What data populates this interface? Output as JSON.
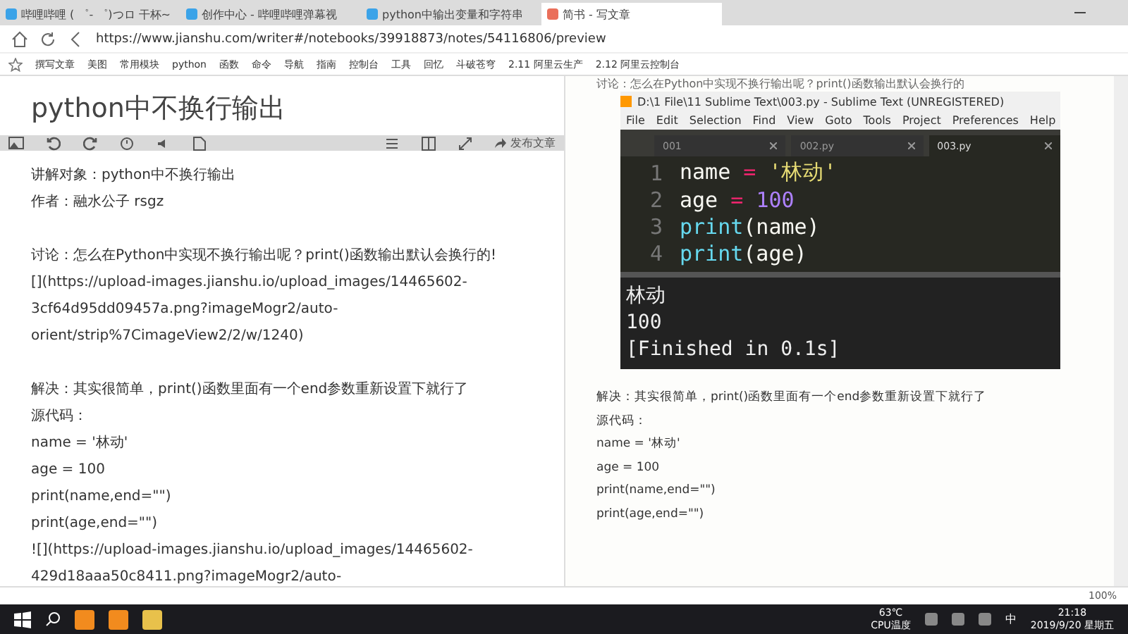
{
  "browser": {
    "tabs": [
      {
        "label": "哔哩哔哩 ( ゜- ゜)つロ 干杯~",
        "selected": false
      },
      {
        "label": "创作中心 - 哔哩哔哩弹幕视",
        "selected": false
      },
      {
        "label": "python中输出变量和字符串",
        "selected": false
      },
      {
        "label": "简书 - 写文章",
        "selected": true
      }
    ],
    "url": "https://www.jianshu.com/writer#/notebooks/39918873/notes/54116806/preview",
    "bookmarks": [
      "撰写文章",
      "美图",
      "常用模块",
      "python",
      "函数",
      "命令",
      "导航",
      "指南",
      "控制台",
      "工具",
      "回忆",
      "斗破苍穹",
      "2.11 阿里云生产",
      "2.12 阿里云控制台"
    ],
    "zoom": "100%"
  },
  "editor": {
    "title": "python中不换行输出",
    "publish": "发布文章",
    "paragraphs": [
      [
        "讲解对象：python中不换行输出",
        "作者：融水公子 rsgz"
      ],
      [
        "讨论：怎么在Python中实现不换行输出呢？print()函数输出默认会换行的!",
        "[](https://upload-images.jianshu.io/upload_images/14465602-",
        "3cf64d95dd09457a.png?imageMogr2/auto-",
        "orient/strip%7CimageView2/2/w/1240)"
      ],
      [
        "解决：其实很简单，print()函数里面有一个end参数重新设置下就行了",
        "源代码：",
        "name = '林动'",
        "age = 100",
        "print(name,end=\"\")",
        "print(age,end=\"\")",
        "![](https://upload-images.jianshu.io/upload_images/14465602-",
        "429d18aaa50c8411.png?imageMogr2/auto-"
      ]
    ]
  },
  "preview": {
    "top_line": "讨论：怎么在Python中实现不换行输出呢？print()函数输出默认会换行的",
    "sublime": {
      "title": "D:\\1 File\\11 Sublime Text\\003.py - Sublime Text (UNREGISTERED)",
      "menu": [
        "File",
        "Edit",
        "Selection",
        "Find",
        "View",
        "Goto",
        "Tools",
        "Project",
        "Preferences",
        "Help"
      ],
      "tabs": [
        {
          "label": "001",
          "selected": false
        },
        {
          "label": "002.py",
          "selected": false
        },
        {
          "label": "003.py",
          "selected": true
        }
      ],
      "code": [
        {
          "number": "1",
          "tokens": [
            {
              "text": "name ",
              "kind": "ident"
            },
            {
              "text": "= ",
              "kind": "op"
            },
            {
              "text": "'林动'",
              "kind": "string"
            }
          ]
        },
        {
          "number": "2",
          "tokens": [
            {
              "text": "age ",
              "kind": "ident"
            },
            {
              "text": "= ",
              "kind": "op"
            },
            {
              "text": "100",
              "kind": "number"
            }
          ]
        },
        {
          "number": "3",
          "tokens": [
            {
              "text": "print",
              "kind": "func"
            },
            {
              "text": "(name)",
              "kind": "ident"
            }
          ]
        },
        {
          "number": "4",
          "tokens": [
            {
              "text": "print",
              "kind": "func"
            },
            {
              "text": "(age)",
              "kind": "ident"
            }
          ]
        }
      ],
      "output": [
        "林动",
        "100",
        "[Finished in 0.1s]"
      ]
    },
    "lines": [
      "解决：其实很简单，print()函数里面有一个end参数重新设置下就行了",
      "源代码：",
      "name = '林动'",
      "age = 100",
      "print(name,end=\"\")",
      "print(age,end=\"\")"
    ]
  },
  "taskbar": {
    "temperature": "63℃",
    "temperature_label": "CPU温度",
    "ime": "中",
    "time": "21:18",
    "date": "2019/9/20 星期五"
  }
}
